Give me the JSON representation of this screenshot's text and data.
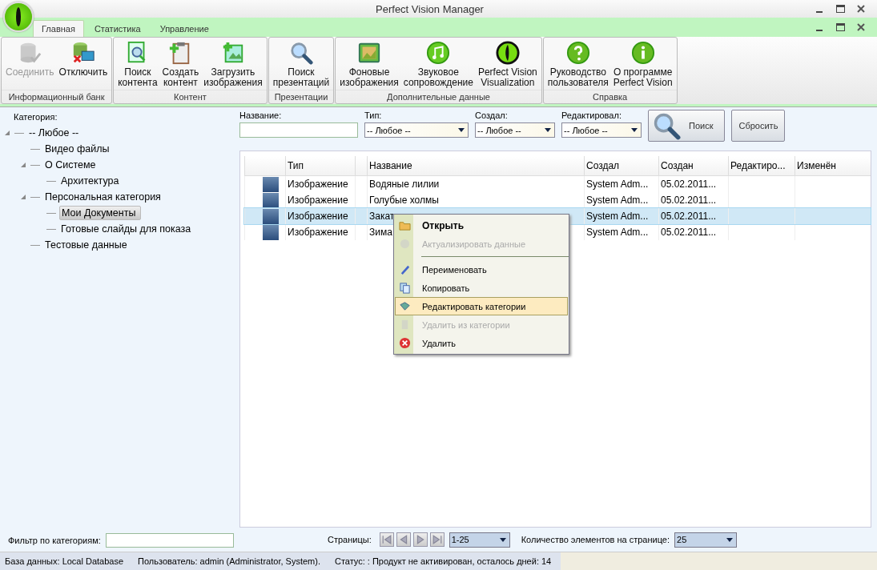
{
  "window": {
    "title": "Perfect Vision Manager"
  },
  "tabs": [
    {
      "label": "Главная",
      "selected": true
    },
    {
      "label": "Статистика",
      "selected": false
    },
    {
      "label": "Управление",
      "selected": false
    }
  ],
  "ribbon_groups": [
    {
      "label": "Информационный банк",
      "buttons": [
        {
          "label": "Соединить",
          "disabled": true
        },
        {
          "label": "Отключить",
          "disabled": false
        }
      ]
    },
    {
      "label": "Контент",
      "buttons": [
        {
          "label": "Поиск\nконтента",
          "disabled": false
        },
        {
          "label": "Создать\nконтент",
          "disabled": false
        },
        {
          "label": "Загрузить\nизображения",
          "disabled": false
        }
      ]
    },
    {
      "label": "Презентации",
      "buttons": [
        {
          "label": "Поиск\nпрезентаций",
          "disabled": false
        }
      ]
    },
    {
      "label": "Дополнительные данные",
      "buttons": [
        {
          "label": "Фоновые\nизображения",
          "disabled": false
        },
        {
          "label": "Звуковое\nсопровождение",
          "disabled": false
        },
        {
          "label": "Perfect Vision\nVisualization",
          "disabled": false
        }
      ]
    },
    {
      "label": "Справка",
      "buttons": [
        {
          "label": "Руководство\nпользователя",
          "disabled": false
        },
        {
          "label": "О программе\nPerfect Vision",
          "disabled": false
        }
      ]
    }
  ],
  "sidebar": {
    "label": "Категория:",
    "tree": [
      {
        "label": "-- Любое --",
        "expanded": true,
        "selected": false,
        "children": [
          {
            "label": "Видео файлы",
            "selected": false
          },
          {
            "label": "О Системе",
            "expanded": true,
            "selected": false,
            "children": [
              {
                "label": "Архитектура",
                "selected": false
              }
            ]
          },
          {
            "label": "Персональная категория",
            "expanded": true,
            "selected": false,
            "children": [
              {
                "label": "Мои Документы",
                "selected": true
              },
              {
                "label": "Готовые слайды для показа",
                "selected": false
              }
            ]
          },
          {
            "label": "Тестовые данные",
            "selected": false
          }
        ]
      }
    ],
    "filter": {
      "label": "Фильтр по категориям:"
    }
  },
  "search": {
    "name": {
      "label": "Название:"
    },
    "type": {
      "label": "Тип:",
      "value": "-- Любое --"
    },
    "created_by": {
      "label": "Создал:",
      "value": "-- Любое --"
    },
    "edited_by": {
      "label": "Редактировал:",
      "value": "-- Любое --"
    },
    "search_button": "Поиск",
    "reset_button": "Сбросить"
  },
  "table": {
    "columns": [
      "Тип",
      "Название",
      "Создал",
      "Создан",
      "Редактиро...",
      "Изменён"
    ],
    "rows": [
      {
        "type": "Изображение",
        "name": "Водяные лилии",
        "created_by": "System Adm...",
        "created": "05.02.2011...",
        "selected": false
      },
      {
        "type": "Изображение",
        "name": "Голубые холмы",
        "created_by": "System Adm...",
        "created": "05.02.2011...",
        "selected": false
      },
      {
        "type": "Изображение",
        "name": "Закат",
        "created_by": "System Adm...",
        "created": "05.02.2011...",
        "selected": true
      },
      {
        "type": "Изображение",
        "name": "Зима",
        "created_by": "System Adm...",
        "created": "05.02.2011...",
        "selected": false
      }
    ]
  },
  "context_menu": [
    {
      "kind": "item",
      "label": "Открыть",
      "default": true,
      "disabled": false,
      "selected": false
    },
    {
      "kind": "item",
      "label": "Актуализировать данные",
      "default": false,
      "disabled": true,
      "selected": false
    },
    {
      "kind": "separator"
    },
    {
      "kind": "item",
      "label": "Переименовать",
      "default": false,
      "disabled": false,
      "selected": false
    },
    {
      "kind": "item",
      "label": "Копировать",
      "default": false,
      "disabled": false,
      "selected": false
    },
    {
      "kind": "item",
      "label": "Редактировать категории",
      "default": false,
      "disabled": false,
      "selected": true
    },
    {
      "kind": "item",
      "label": "Удалить из категории",
      "default": false,
      "disabled": true,
      "selected": false
    },
    {
      "kind": "item",
      "label": "Удалить",
      "default": false,
      "disabled": false,
      "selected": false
    }
  ],
  "pager": {
    "label": "Страницы:",
    "range": "1-25",
    "per_page_label": "Количество элементов на странице:",
    "per_page": "25"
  },
  "status_bar": [
    "База данных: Local Database",
    "Пользователь: admin (Administrator, System).",
    "Статус: : Продукт не активирован, осталось дней: 14"
  ]
}
